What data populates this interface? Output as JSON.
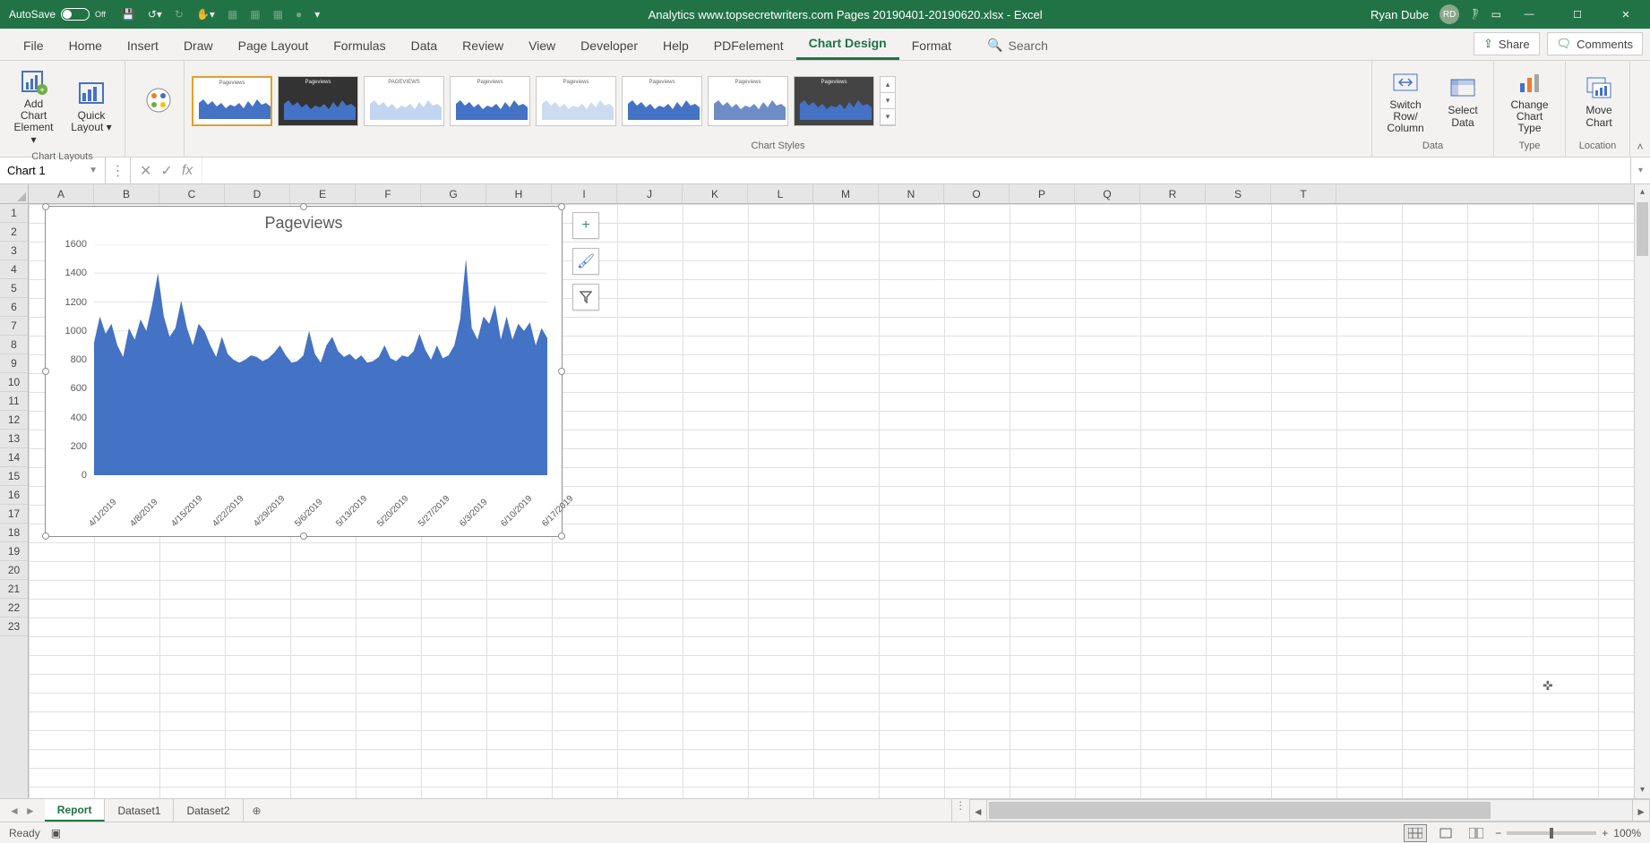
{
  "titlebar": {
    "autosave_label": "AutoSave",
    "autosave_state": "Off",
    "document_title": "Analytics www.topsecretwriters.com Pages 20190401-20190620.xlsx  -  Excel",
    "user_name": "Ryan Dube",
    "user_initials": "RD"
  },
  "tabs": {
    "items": [
      "File",
      "Home",
      "Insert",
      "Draw",
      "Page Layout",
      "Formulas",
      "Data",
      "Review",
      "View",
      "Developer",
      "Help",
      "PDFelement",
      "Chart Design",
      "Format"
    ],
    "active": "Chart Design",
    "search_placeholder": "Search",
    "share_label": "Share",
    "comments_label": "Comments"
  },
  "ribbon": {
    "groups": {
      "chart_layouts": {
        "add_element": "Add Chart Element ▾",
        "quick_layout": "Quick Layout ▾",
        "label": "Chart Layouts"
      },
      "change_colors": "Change Colors ▾",
      "styles_label": "Chart Styles",
      "data": {
        "switch": "Switch Row/ Column",
        "select": "Select Data",
        "label": "Data"
      },
      "type": {
        "change": "Change Chart Type",
        "label": "Type"
      },
      "location": {
        "move": "Move Chart",
        "label": "Location"
      }
    }
  },
  "formula_bar": {
    "name_box": "Chart 1",
    "fx_label": "fx",
    "formula": ""
  },
  "grid": {
    "columns": [
      "A",
      "B",
      "C",
      "D",
      "E",
      "F",
      "G",
      "H",
      "I",
      "J",
      "K",
      "L",
      "M",
      "N",
      "O",
      "P",
      "Q",
      "R",
      "S",
      "T"
    ],
    "row_count": 23
  },
  "chart_buttons": {
    "plus": "+",
    "brush": "✎",
    "filter": "▼"
  },
  "chart_data": {
    "type": "area",
    "title": "Pageviews",
    "ylabel": "",
    "xlabel": "",
    "ylim": [
      0,
      1600
    ],
    "y_ticks": [
      0,
      200,
      400,
      600,
      800,
      1000,
      1200,
      1400,
      1600
    ],
    "x_tick_labels": [
      "4/1/2019",
      "4/8/2019",
      "4/15/2019",
      "4/22/2019",
      "4/29/2019",
      "5/6/2019",
      "5/13/2019",
      "5/20/2019",
      "5/27/2019",
      "6/3/2019",
      "6/10/2019",
      "6/17/2019"
    ],
    "values": [
      920,
      1100,
      980,
      1050,
      900,
      820,
      1020,
      940,
      1080,
      1000,
      1180,
      1400,
      1100,
      960,
      1020,
      1210,
      1020,
      900,
      1050,
      1000,
      900,
      820,
      960,
      840,
      800,
      780,
      800,
      830,
      820,
      790,
      810,
      850,
      900,
      830,
      780,
      790,
      830,
      1000,
      840,
      780,
      900,
      960,
      860,
      820,
      840,
      800,
      830,
      780,
      790,
      820,
      900,
      810,
      790,
      830,
      820,
      860,
      980,
      870,
      800,
      900,
      810,
      830,
      900,
      1080,
      1500,
      1020,
      940,
      1100,
      1050,
      1180,
      940,
      1100,
      940,
      1050,
      1000,
      1060,
      900,
      1020,
      950
    ]
  },
  "sheet_tabs": {
    "items": [
      "Report",
      "Dataset1",
      "Dataset2"
    ],
    "active": "Report"
  },
  "status": {
    "ready": "Ready",
    "zoom": "100%"
  }
}
